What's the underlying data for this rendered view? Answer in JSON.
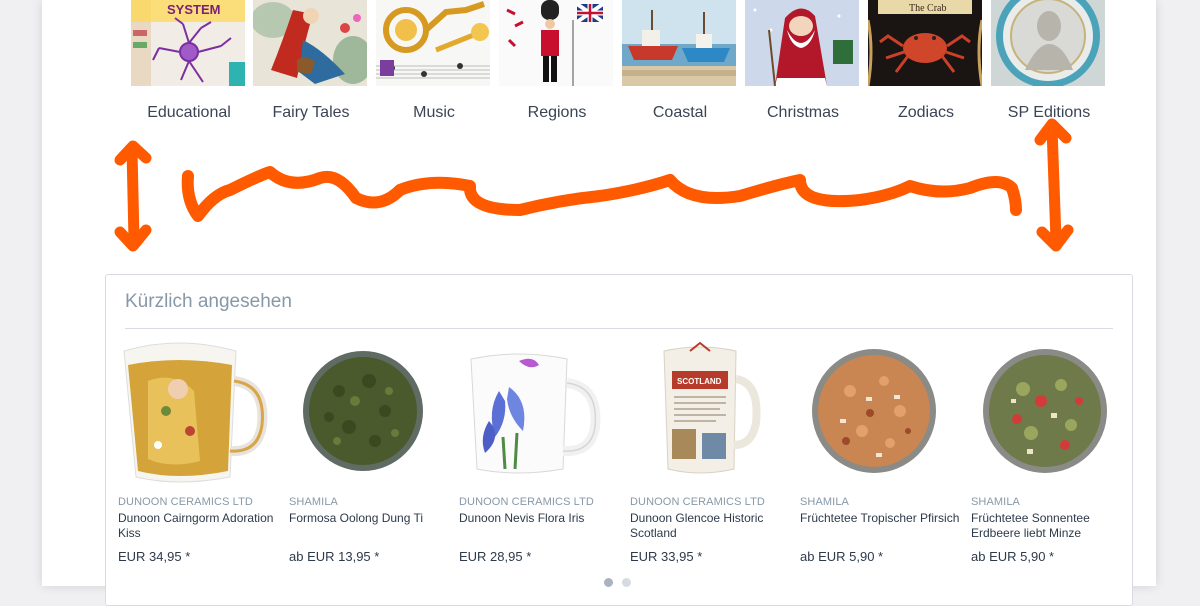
{
  "categories": [
    {
      "label": "Educational",
      "thumb": "nervous-system-poster"
    },
    {
      "label": "Fairy Tales",
      "thumb": "red-riding-hood"
    },
    {
      "label": "Music",
      "thumb": "brass-instruments"
    },
    {
      "label": "Regions",
      "thumb": "london-guard"
    },
    {
      "label": "Coastal",
      "thumb": "fishing-boats"
    },
    {
      "label": "Christmas",
      "thumb": "santa-claus"
    },
    {
      "label": "Zodiacs",
      "thumb": "crab-zodiac",
      "thumb_text": "The Crab"
    },
    {
      "label": "SP Editions",
      "thumb": "cameo-portrait"
    }
  ],
  "recently_viewed": {
    "title": "Kürzlich angesehen",
    "products": [
      {
        "supplier": "DUNOON CERAMICS LTD",
        "name": "Dunoon Cairngorm Adoration Kiss",
        "price": "EUR 34,95 *",
        "image": "mug-gold-kiss"
      },
      {
        "supplier": "SHAMILA",
        "name": "Formosa Oolong Dung Ti",
        "price": "ab EUR 13,95 *",
        "image": "bowl-oolong-tea"
      },
      {
        "supplier": "DUNOON CERAMICS LTD",
        "name": "Dunoon Nevis Flora Iris",
        "price": "EUR 28,95 *",
        "image": "mug-blue-iris"
      },
      {
        "supplier": "DUNOON CERAMICS LTD",
        "name": "Dunoon Glencoe Historic Scotland",
        "price": "EUR 33,95 *",
        "image": "mug-historic-scotland",
        "image_text": "SCOTLAND"
      },
      {
        "supplier": "SHAMILA",
        "name": "Früchtetee Tropischer Pfirsich",
        "price": "ab EUR 5,90 *",
        "image": "bowl-fruit-tea-peach"
      },
      {
        "supplier": "SHAMILA",
        "name": "Früchtetee Sonnentee Erdbeere liebt Minze",
        "price": "ab EUR 5,90 *",
        "image": "bowl-fruit-tea-strawberry-mint"
      }
    ]
  },
  "slider": {
    "pages": 2,
    "active": 1
  },
  "annotation": {
    "color": "#ff5a00"
  }
}
